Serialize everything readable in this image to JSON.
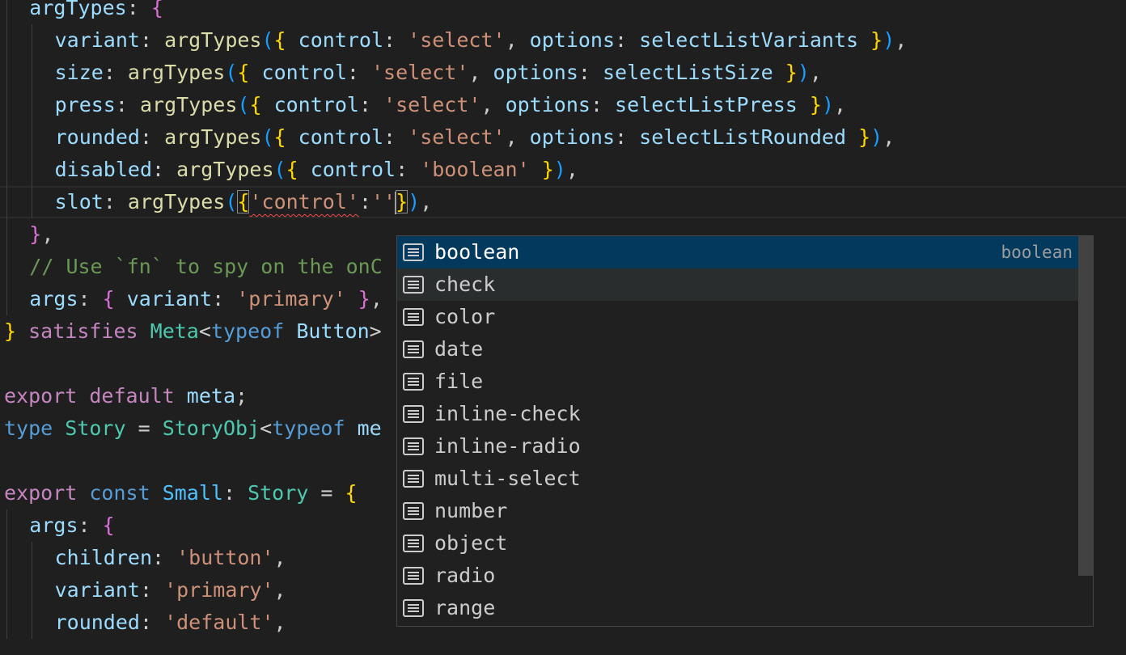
{
  "editor": {
    "lines": [
      {
        "indent": 1,
        "tokens": [
          {
            "t": "argTypes",
            "c": "var"
          },
          {
            "t": ": ",
            "c": "pun"
          },
          {
            "t": "{",
            "c": "b2"
          }
        ]
      },
      {
        "indent": 2,
        "tokens": [
          {
            "t": "variant",
            "c": "var"
          },
          {
            "t": ": ",
            "c": "pun"
          },
          {
            "t": "argTypes",
            "c": "fn"
          },
          {
            "t": "(",
            "c": "b3"
          },
          {
            "t": "{",
            "c": "b1"
          },
          {
            "t": " ",
            "c": "pun"
          },
          {
            "t": "control",
            "c": "var"
          },
          {
            "t": ": ",
            "c": "pun"
          },
          {
            "t": "'select'",
            "c": "str"
          },
          {
            "t": ", ",
            "c": "pun"
          },
          {
            "t": "options",
            "c": "var"
          },
          {
            "t": ": ",
            "c": "pun"
          },
          {
            "t": "selectListVariants",
            "c": "var"
          },
          {
            "t": " ",
            "c": "pun"
          },
          {
            "t": "}",
            "c": "b1"
          },
          {
            "t": ")",
            "c": "b3"
          },
          {
            "t": ",",
            "c": "pun"
          }
        ]
      },
      {
        "indent": 2,
        "tokens": [
          {
            "t": "size",
            "c": "var"
          },
          {
            "t": ": ",
            "c": "pun"
          },
          {
            "t": "argTypes",
            "c": "fn"
          },
          {
            "t": "(",
            "c": "b3"
          },
          {
            "t": "{",
            "c": "b1"
          },
          {
            "t": " ",
            "c": "pun"
          },
          {
            "t": "control",
            "c": "var"
          },
          {
            "t": ": ",
            "c": "pun"
          },
          {
            "t": "'select'",
            "c": "str"
          },
          {
            "t": ", ",
            "c": "pun"
          },
          {
            "t": "options",
            "c": "var"
          },
          {
            "t": ": ",
            "c": "pun"
          },
          {
            "t": "selectListSize",
            "c": "var"
          },
          {
            "t": " ",
            "c": "pun"
          },
          {
            "t": "}",
            "c": "b1"
          },
          {
            "t": ")",
            "c": "b3"
          },
          {
            "t": ",",
            "c": "pun"
          }
        ]
      },
      {
        "indent": 2,
        "tokens": [
          {
            "t": "press",
            "c": "var"
          },
          {
            "t": ": ",
            "c": "pun"
          },
          {
            "t": "argTypes",
            "c": "fn"
          },
          {
            "t": "(",
            "c": "b3"
          },
          {
            "t": "{",
            "c": "b1"
          },
          {
            "t": " ",
            "c": "pun"
          },
          {
            "t": "control",
            "c": "var"
          },
          {
            "t": ": ",
            "c": "pun"
          },
          {
            "t": "'select'",
            "c": "str"
          },
          {
            "t": ", ",
            "c": "pun"
          },
          {
            "t": "options",
            "c": "var"
          },
          {
            "t": ": ",
            "c": "pun"
          },
          {
            "t": "selectListPress",
            "c": "var"
          },
          {
            "t": " ",
            "c": "pun"
          },
          {
            "t": "}",
            "c": "b1"
          },
          {
            "t": ")",
            "c": "b3"
          },
          {
            "t": ",",
            "c": "pun"
          }
        ]
      },
      {
        "indent": 2,
        "tokens": [
          {
            "t": "rounded",
            "c": "var"
          },
          {
            "t": ": ",
            "c": "pun"
          },
          {
            "t": "argTypes",
            "c": "fn"
          },
          {
            "t": "(",
            "c": "b3"
          },
          {
            "t": "{",
            "c": "b1"
          },
          {
            "t": " ",
            "c": "pun"
          },
          {
            "t": "control",
            "c": "var"
          },
          {
            "t": ": ",
            "c": "pun"
          },
          {
            "t": "'select'",
            "c": "str"
          },
          {
            "t": ", ",
            "c": "pun"
          },
          {
            "t": "options",
            "c": "var"
          },
          {
            "t": ": ",
            "c": "pun"
          },
          {
            "t": "selectListRounded",
            "c": "var"
          },
          {
            "t": " ",
            "c": "pun"
          },
          {
            "t": "}",
            "c": "b1"
          },
          {
            "t": ")",
            "c": "b3"
          },
          {
            "t": ",",
            "c": "pun"
          }
        ]
      },
      {
        "indent": 2,
        "tokens": [
          {
            "t": "disabled",
            "c": "var"
          },
          {
            "t": ": ",
            "c": "pun"
          },
          {
            "t": "argTypes",
            "c": "fn"
          },
          {
            "t": "(",
            "c": "b3"
          },
          {
            "t": "{",
            "c": "b1"
          },
          {
            "t": " ",
            "c": "pun"
          },
          {
            "t": "control",
            "c": "var"
          },
          {
            "t": ": ",
            "c": "pun"
          },
          {
            "t": "'boolean'",
            "c": "str"
          },
          {
            "t": " ",
            "c": "pun"
          },
          {
            "t": "}",
            "c": "b1"
          },
          {
            "t": ")",
            "c": "b3"
          },
          {
            "t": ",",
            "c": "pun"
          }
        ]
      },
      {
        "indent": 2,
        "current": true,
        "tokens": [
          {
            "t": "slot",
            "c": "var"
          },
          {
            "t": ": ",
            "c": "pun"
          },
          {
            "t": "argTypes",
            "c": "fn"
          },
          {
            "t": "(",
            "c": "b3"
          },
          {
            "t": "{",
            "c": "b1 bm"
          },
          {
            "t": "'control'",
            "c": "str squig"
          },
          {
            "t": ":",
            "c": "pun"
          },
          {
            "t": "''",
            "c": "str"
          },
          {
            "cursor": true
          },
          {
            "t": "}",
            "c": "b1 bm"
          },
          {
            "t": ")",
            "c": "b3"
          },
          {
            "t": ",",
            "c": "pun"
          }
        ]
      },
      {
        "indent": 1,
        "tokens": [
          {
            "t": "}",
            "c": "b2"
          },
          {
            "t": ",",
            "c": "pun"
          }
        ]
      },
      {
        "indent": 1,
        "tokens": [
          {
            "t": "// Use `fn` to spy on the onC",
            "c": "cm"
          }
        ]
      },
      {
        "indent": 1,
        "tokens": [
          {
            "t": "args",
            "c": "var"
          },
          {
            "t": ": ",
            "c": "pun"
          },
          {
            "t": "{",
            "c": "b2"
          },
          {
            "t": " ",
            "c": "pun"
          },
          {
            "t": "variant",
            "c": "var"
          },
          {
            "t": ": ",
            "c": "pun"
          },
          {
            "t": "'primary'",
            "c": "str"
          },
          {
            "t": " ",
            "c": "pun"
          },
          {
            "t": "}",
            "c": "b2"
          },
          {
            "t": ",",
            "c": "pun"
          }
        ]
      },
      {
        "indent": 0,
        "tokens": [
          {
            "t": "}",
            "c": "b1"
          },
          {
            "t": " ",
            "c": "pun"
          },
          {
            "t": "satisfies",
            "c": "kw"
          },
          {
            "t": " ",
            "c": "pun"
          },
          {
            "t": "Meta",
            "c": "type"
          },
          {
            "t": "<",
            "c": "pun"
          },
          {
            "t": "typeof",
            "c": "blue"
          },
          {
            "t": " ",
            "c": "pun"
          },
          {
            "t": "Button",
            "c": "var"
          },
          {
            "t": ">",
            "c": "pun"
          }
        ]
      },
      {
        "indent": 0,
        "tokens": []
      },
      {
        "indent": 0,
        "tokens": [
          {
            "t": "export",
            "c": "kw"
          },
          {
            "t": " ",
            "c": "pun"
          },
          {
            "t": "default",
            "c": "kw"
          },
          {
            "t": " ",
            "c": "pun"
          },
          {
            "t": "meta",
            "c": "var"
          },
          {
            "t": ";",
            "c": "pun"
          }
        ]
      },
      {
        "indent": 0,
        "tokens": [
          {
            "t": "type",
            "c": "blue"
          },
          {
            "t": " ",
            "c": "pun"
          },
          {
            "t": "Story",
            "c": "type"
          },
          {
            "t": " = ",
            "c": "pun"
          },
          {
            "t": "StoryObj",
            "c": "type"
          },
          {
            "t": "<",
            "c": "pun"
          },
          {
            "t": "typeof",
            "c": "blue"
          },
          {
            "t": " ",
            "c": "pun"
          },
          {
            "t": "me",
            "c": "var"
          }
        ]
      },
      {
        "indent": 0,
        "tokens": []
      },
      {
        "indent": 0,
        "tokens": [
          {
            "t": "export",
            "c": "kw"
          },
          {
            "t": " ",
            "c": "pun"
          },
          {
            "t": "const",
            "c": "blue"
          },
          {
            "t": " ",
            "c": "pun"
          },
          {
            "t": "Small",
            "c": "const"
          },
          {
            "t": ": ",
            "c": "pun"
          },
          {
            "t": "Story",
            "c": "type"
          },
          {
            "t": " = ",
            "c": "pun"
          },
          {
            "t": "{",
            "c": "b1"
          }
        ]
      },
      {
        "indent": 1,
        "tokens": [
          {
            "t": "args",
            "c": "var"
          },
          {
            "t": ": ",
            "c": "pun"
          },
          {
            "t": "{",
            "c": "b2"
          }
        ]
      },
      {
        "indent": 2,
        "tokens": [
          {
            "t": "children",
            "c": "var"
          },
          {
            "t": ": ",
            "c": "pun"
          },
          {
            "t": "'button'",
            "c": "str"
          },
          {
            "t": ",",
            "c": "pun"
          }
        ]
      },
      {
        "indent": 2,
        "tokens": [
          {
            "t": "variant",
            "c": "var"
          },
          {
            "t": ": ",
            "c": "pun"
          },
          {
            "t": "'primary'",
            "c": "str"
          },
          {
            "t": ",",
            "c": "pun"
          }
        ]
      },
      {
        "indent": 2,
        "tokens": [
          {
            "t": "rounded",
            "c": "var"
          },
          {
            "t": ": ",
            "c": "pun"
          },
          {
            "t": "'default'",
            "c": "str"
          },
          {
            "t": ",",
            "c": "pun"
          }
        ]
      }
    ]
  },
  "suggest": {
    "items": [
      {
        "label": "boolean",
        "detail": "boolean",
        "state": "selected"
      },
      {
        "label": "check",
        "detail": "",
        "state": "hover"
      },
      {
        "label": "color",
        "detail": "",
        "state": ""
      },
      {
        "label": "date",
        "detail": "",
        "state": ""
      },
      {
        "label": "file",
        "detail": "",
        "state": ""
      },
      {
        "label": "inline-check",
        "detail": "",
        "state": ""
      },
      {
        "label": "inline-radio",
        "detail": "",
        "state": ""
      },
      {
        "label": "multi-select",
        "detail": "",
        "state": ""
      },
      {
        "label": "number",
        "detail": "",
        "state": ""
      },
      {
        "label": "object",
        "detail": "",
        "state": ""
      },
      {
        "label": "radio",
        "detail": "",
        "state": ""
      },
      {
        "label": "range",
        "detail": "",
        "state": ""
      }
    ],
    "icon": "text-value-icon"
  }
}
